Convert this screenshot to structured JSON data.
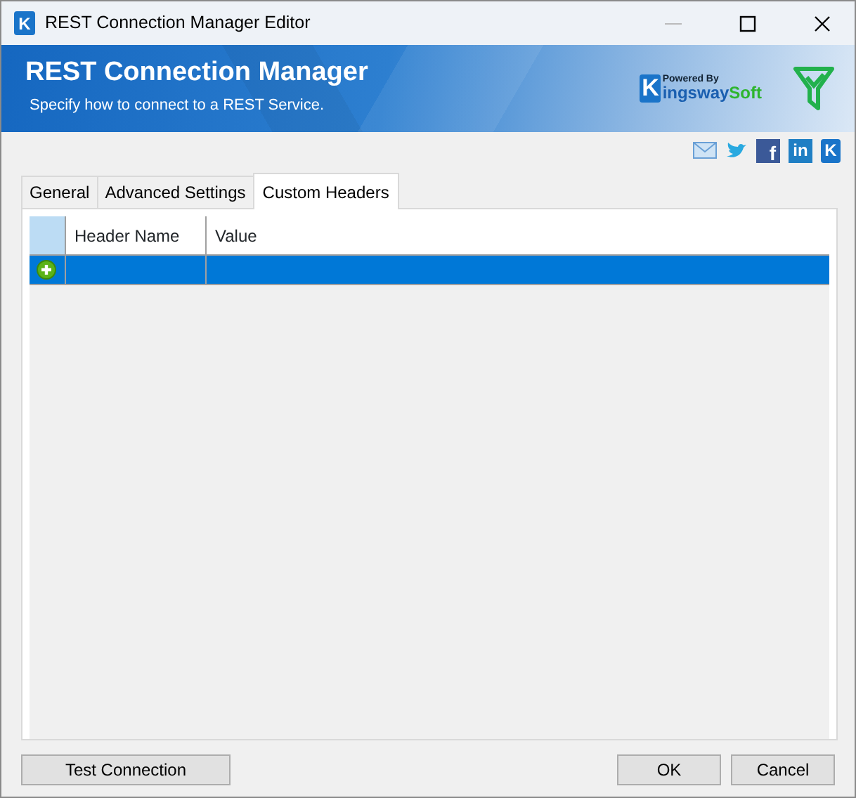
{
  "window": {
    "title": "REST Connection Manager Editor",
    "app_icon_text": "K"
  },
  "banner": {
    "title": "REST Connection Manager",
    "subtitle": "Specify how to connect to a REST Service.",
    "logo": {
      "mark": "K",
      "powered_by": "Powered By",
      "name_1": "ingsway",
      "name_2": "Soft"
    }
  },
  "social": [
    {
      "kind": "mail"
    },
    {
      "kind": "twitter"
    },
    {
      "kind": "facebook",
      "glyph": "f"
    },
    {
      "kind": "linkedin",
      "glyph": "in"
    },
    {
      "kind": "kingsway",
      "glyph": "K"
    }
  ],
  "tabs": [
    {
      "label": "General",
      "selected": false
    },
    {
      "label": "Advanced Settings",
      "selected": false
    },
    {
      "label": "Custom Headers",
      "selected": true
    }
  ],
  "table": {
    "columns": [
      "Header Name",
      "Value"
    ],
    "rows": [
      {
        "kind": "new",
        "selected": true,
        "cells": [
          "",
          ""
        ]
      }
    ]
  },
  "buttons": {
    "left": [
      "Test Connection"
    ],
    "right": [
      "OK",
      "Cancel"
    ]
  }
}
